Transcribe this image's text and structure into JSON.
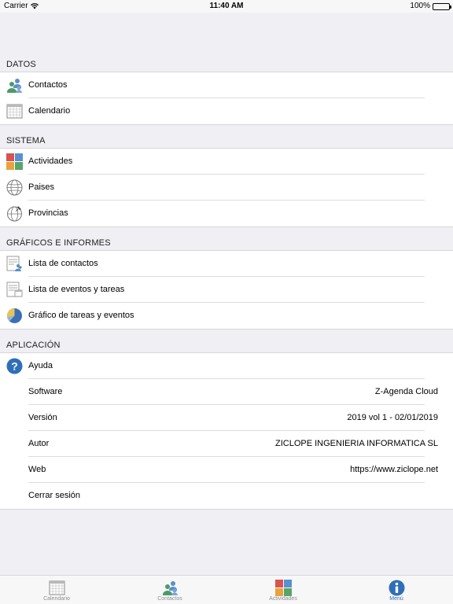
{
  "status_bar": {
    "carrier": "Carrier",
    "time": "11:40 AM",
    "battery": "100%"
  },
  "sections": {
    "datos": {
      "header": "DATOS",
      "items": [
        {
          "label": "Contactos",
          "icon": "contacts-icon"
        },
        {
          "label": "Calendario",
          "icon": "calendar-icon"
        }
      ]
    },
    "sistema": {
      "header": "SISTEMA",
      "items": [
        {
          "label": "Actividades",
          "icon": "activities-icon"
        },
        {
          "label": "Paises",
          "icon": "globe-icon"
        },
        {
          "label": "Provincias",
          "icon": "globe-pin-icon"
        }
      ]
    },
    "graficos": {
      "header": "GRÁFICOS E INFORMES",
      "items": [
        {
          "label": "Lista de contactos",
          "icon": "contacts-report-icon"
        },
        {
          "label": "Lista de eventos y tareas",
          "icon": "events-report-icon"
        },
        {
          "label": "Gráfico de tareas y eventos",
          "icon": "pie-chart-icon"
        }
      ]
    },
    "aplicacion": {
      "header": "APLICACIÓN",
      "help": {
        "label": "Ayuda",
        "icon": "help-icon"
      },
      "info": [
        {
          "label": "Software",
          "value": "Z-Agenda Cloud"
        },
        {
          "label": "Versión",
          "value": "2019 vol 1 - 02/01/2019"
        },
        {
          "label": "Autor",
          "value": "ZICLOPE INGENIERIA INFORMATICA SL"
        },
        {
          "label": "Web",
          "value": "https://www.ziclope.net"
        }
      ],
      "logout": "Cerrar sesión"
    }
  },
  "tab_bar": {
    "tabs": [
      {
        "label": "Calendario",
        "icon": "calendar-icon"
      },
      {
        "label": "Contactos",
        "icon": "contacts-icon"
      },
      {
        "label": "Actividades",
        "icon": "activities-icon"
      },
      {
        "label": "Menú",
        "icon": "info-icon",
        "active": true
      }
    ]
  },
  "colors": {
    "accent": "#2f6fb8",
    "background": "#efeff4"
  }
}
